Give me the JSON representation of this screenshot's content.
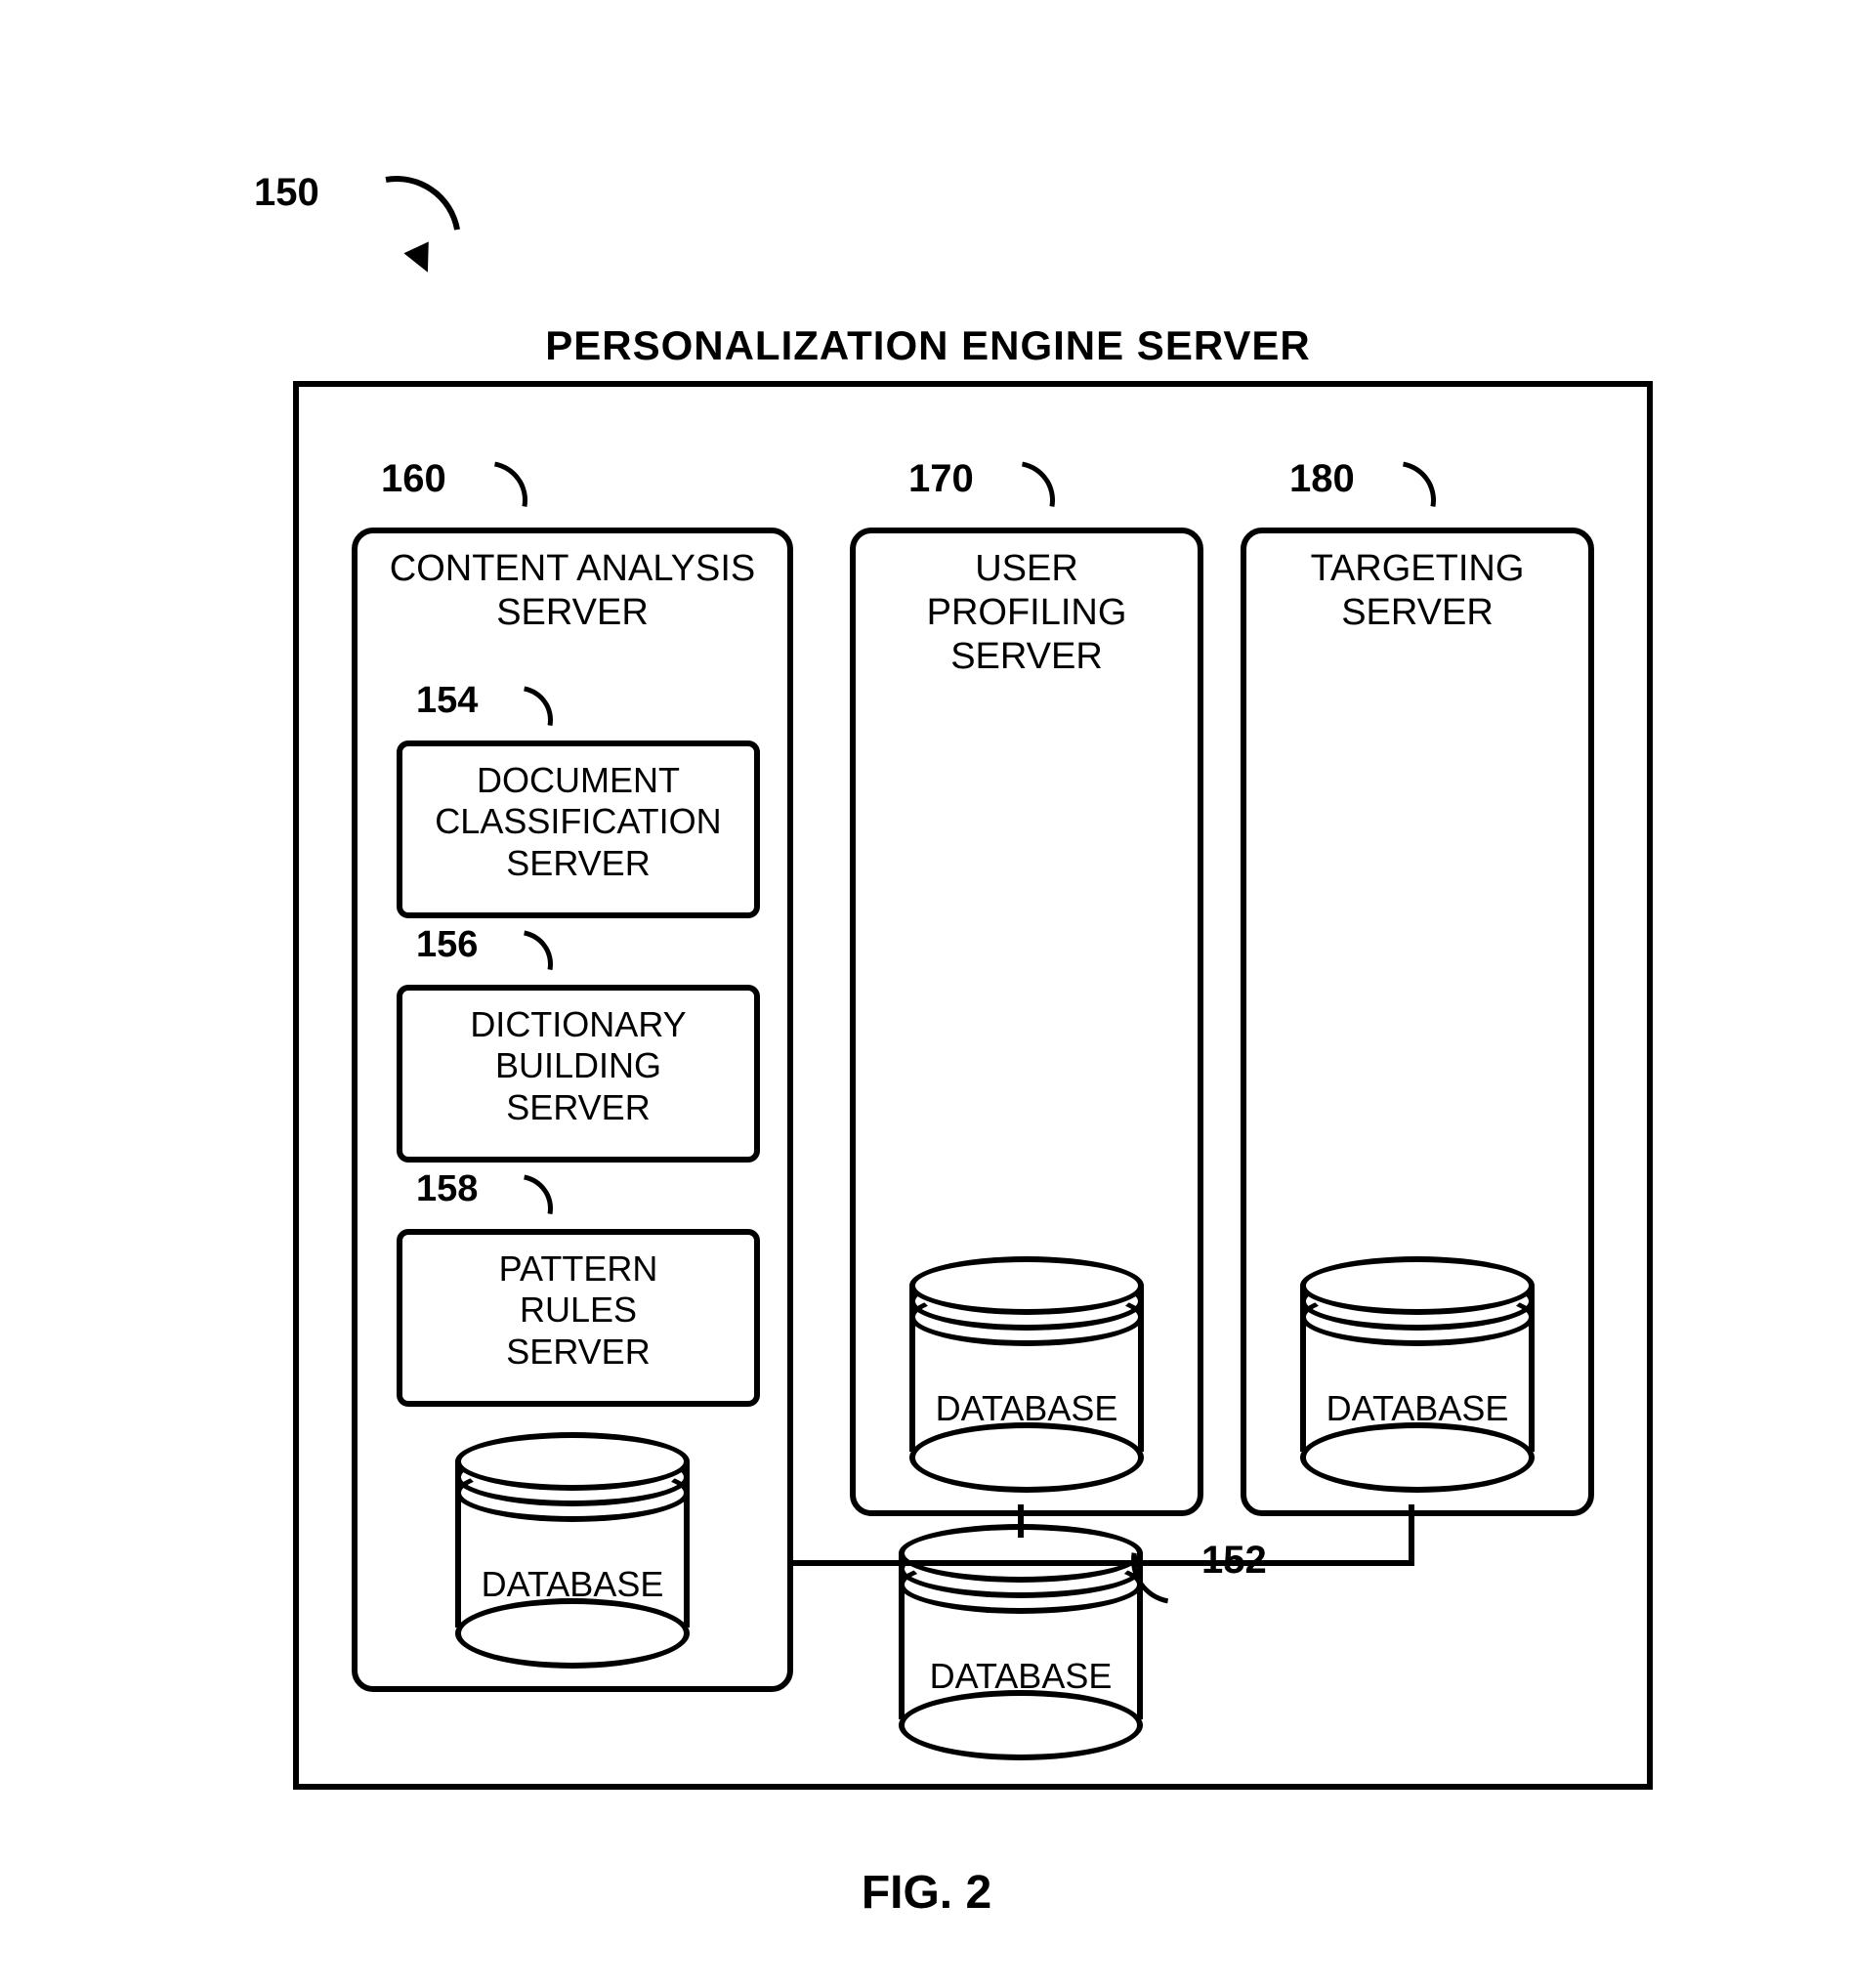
{
  "figure": {
    "ref": "150",
    "title": "PERSONALIZATION ENGINE SERVER",
    "caption": "FIG. 2"
  },
  "servers": {
    "content_analysis": {
      "ref": "160",
      "title": "CONTENT ANALYSIS\nSERVER",
      "db": "DATABASE"
    },
    "user_profiling": {
      "ref": "170",
      "title": "USER\nPROFILING\nSERVER",
      "db": "DATABASE"
    },
    "targeting": {
      "ref": "180",
      "title": "TARGETING\nSERVER",
      "db": "DATABASE"
    }
  },
  "inner_servers": {
    "doc_class": {
      "ref": "154",
      "title": "DOCUMENT\nCLASSIFICATION\nSERVER"
    },
    "dict_build": {
      "ref": "156",
      "title": "DICTIONARY\nBUILDING\nSERVER"
    },
    "pattern": {
      "ref": "158",
      "title": "PATTERN\nRULES\nSERVER"
    }
  },
  "shared_db": {
    "ref": "152",
    "label": "DATABASE"
  }
}
